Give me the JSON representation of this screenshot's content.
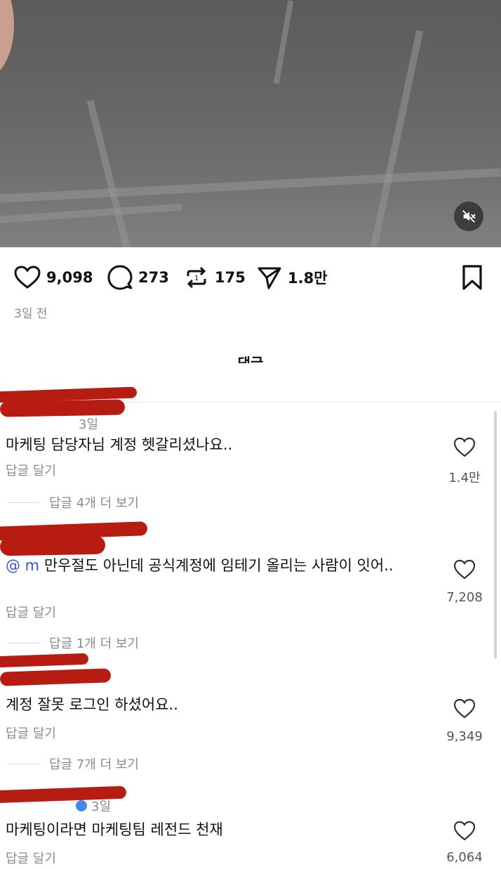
{
  "post": {
    "video": {
      "muted": true,
      "mute_icon": "speaker-muted-icon"
    },
    "actions": {
      "like": {
        "icon": "heart-icon",
        "count": "9,098"
      },
      "comment": {
        "icon": "comment-bubble-icon",
        "count": "273"
      },
      "repost": {
        "icon": "repost-icon",
        "count": "175"
      },
      "share": {
        "icon": "send-icon",
        "count": "1.8만"
      },
      "save": {
        "icon": "bookmark-icon"
      }
    },
    "time": "3일 전"
  },
  "comments_section": {
    "title": "댓글",
    "comments": [
      {
        "author_meta": "3일",
        "text": "마케팅 담당자님 계정 헷갈리셨나요..",
        "reply_label": "답글 달기",
        "likes": "1.4만",
        "view_replies": "답글 4개 더 보기"
      },
      {
        "mention": "@         m",
        "text": " 만우절도 아닌데 공식계정에 임테기 올리는 사람이 잇어..",
        "reply_label": "답글 달기",
        "likes": "7,208",
        "view_replies": "답글 1개 더 보기"
      },
      {
        "text": "계정 잘못 로그인 하셨어요..",
        "reply_label": "답글 달기",
        "likes": "9,349",
        "view_replies": "답글 7개 더 보기"
      },
      {
        "author_meta": "3일",
        "text": "마케팅이라면 마케팅팀 레전드 천재",
        "reply_label": "답글 달기",
        "likes": "6,064"
      }
    ]
  },
  "colors": {
    "redaction": "#b71c12",
    "mention": "#3b55c9",
    "muted_text": "#8a8a8a"
  }
}
